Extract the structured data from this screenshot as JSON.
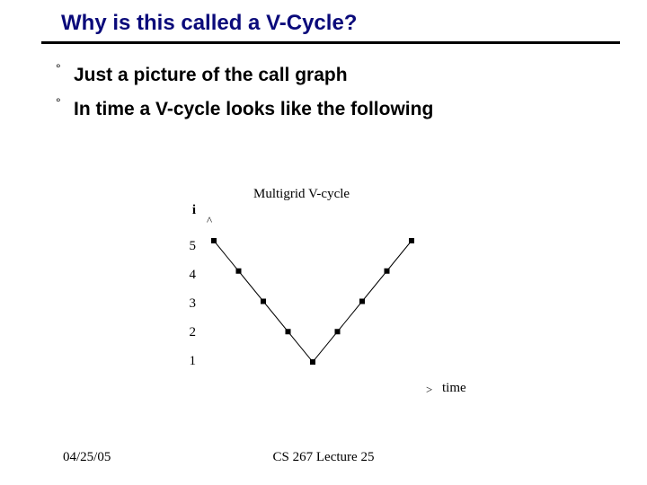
{
  "title": "Why is this called a V-Cycle?",
  "bullets": [
    "Just a picture of the call graph",
    "In time a V-cycle looks like the following"
  ],
  "footer": {
    "date": "04/25/05",
    "course": "CS 267 Lecture 25"
  },
  "chart_data": {
    "type": "line",
    "title": "Multigrid V-cycle",
    "ylabel": "i",
    "xlabel": "time",
    "y_ticks": [
      5,
      4,
      3,
      2,
      1
    ],
    "y_up_marker": "^",
    "x_right_marker": ">",
    "series": [
      {
        "name": "vcycle",
        "points": [
          {
            "x": 1,
            "y": 5
          },
          {
            "x": 2,
            "y": 4
          },
          {
            "x": 3,
            "y": 3
          },
          {
            "x": 4,
            "y": 2
          },
          {
            "x": 5,
            "y": 1
          },
          {
            "x": 6,
            "y": 2
          },
          {
            "x": 7,
            "y": 3
          },
          {
            "x": 8,
            "y": 4
          },
          {
            "x": 9,
            "y": 5
          }
        ]
      }
    ],
    "xlim": [
      0.5,
      9.5
    ],
    "ylim": [
      0.5,
      5.5
    ]
  }
}
